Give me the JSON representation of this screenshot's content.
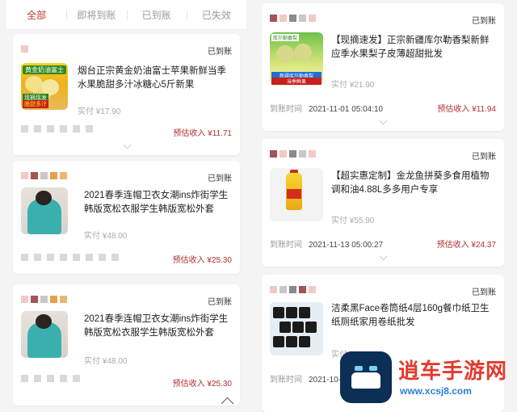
{
  "tabs": [
    "全部",
    "即将到账",
    "已到账",
    "已失效"
  ],
  "colors": {
    "accent": "#c0392b",
    "income": "#b03030"
  },
  "left_cards": [
    {
      "status": "已到账",
      "title": "烟台正宗黄金奶油富士苹果新鲜当季水果脆甜多汁冰糖心5斤新果",
      "thumb_text": [
        "黄金奶油富士",
        "现摘现发",
        "脆甜多汁"
      ],
      "paid": "实付 ¥17.90",
      "income": "预估收入 ¥11.71"
    },
    {
      "status": "已到账",
      "title": "2021春季连帽卫衣女潮ins炸街学生韩版宽松衣服学生韩版宽松外套",
      "paid": "实付 ¥48.00",
      "income": "预估收入 ¥25.30"
    },
    {
      "status": "已到账",
      "title": "2021春季连帽卫衣女潮ins炸街学生韩版宽松衣服学生韩版宽松外套",
      "paid": "实付 ¥48.00",
      "income": "预估收入 ¥25.30"
    }
  ],
  "right_cards": [
    {
      "status": "已到账",
      "title": "【现摘速发】正宗新疆库尔勒香梨新鲜应季水果梨子皮薄超甜批发",
      "thumb_text": [
        "库尔勒香梨",
        "新疆库尔勒香梨",
        "当季鲜果"
      ],
      "paid": "实付 ¥21.90",
      "arrive_label": "到账时间",
      "arrive_time": "2021-11-01 05:04:10",
      "income": "预估收入 ¥11.94"
    },
    {
      "status": "已到账",
      "title": "【超实惠定制】金龙鱼拼葵多食用植物调和油4.88L多多用户专享",
      "paid": "实付 ¥55.90",
      "arrive_label": "到账时间",
      "arrive_time": "2021-11-13 05:00:27",
      "income": "预估收入 ¥24.37"
    },
    {
      "status": "已到账",
      "title": "洁柔黑Face卷筒纸4层160g餐巾纸卫生纸厕纸家用卷纸批发",
      "paid": "实付 ¥19.90",
      "arrive_label": "到账时间",
      "arrive_time": "2021-10-3"
    }
  ],
  "watermark": {
    "line1": "逍车手游网",
    "line2": "www.xcsj8.com"
  }
}
